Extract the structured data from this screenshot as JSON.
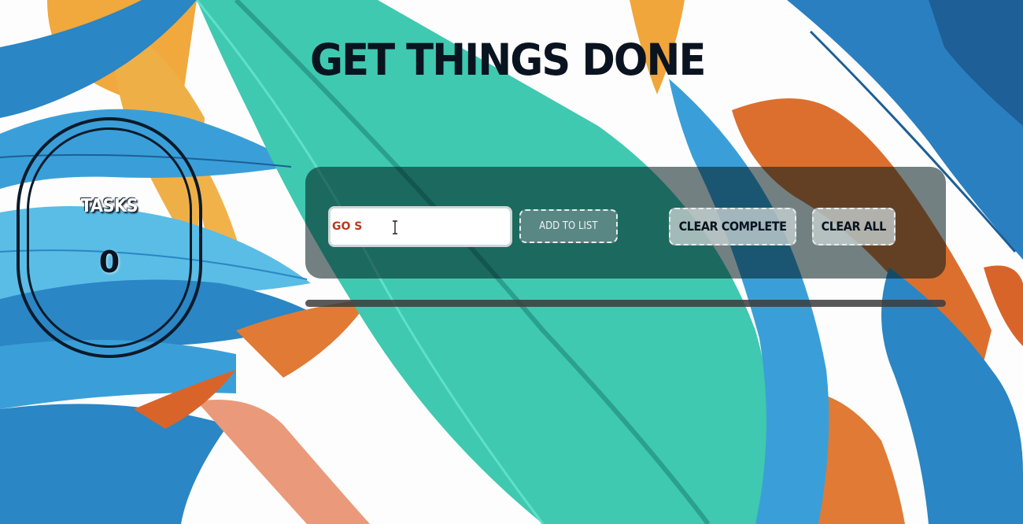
{
  "header": {
    "title": "GET THINGS DONE"
  },
  "counter": {
    "label": "TASKS",
    "value": "0"
  },
  "task_form": {
    "input_value": "GO S",
    "add_label": "ADD TO LIST"
  },
  "actions": {
    "clear_complete_label": "CLEAR COMPLETE",
    "clear_all_label": "CLEAR ALL"
  },
  "progress": {
    "fraction": 0
  },
  "colors": {
    "title": "#0a1420",
    "input_text": "#b83a1e",
    "leaf_teal": "#3fc9b0",
    "leaf_blue": "#2a86c4",
    "leaf_orange": "#f0a63a",
    "leaf_rust": "#d9642a"
  },
  "icons": {
    "cursor": "text-cursor-icon"
  }
}
